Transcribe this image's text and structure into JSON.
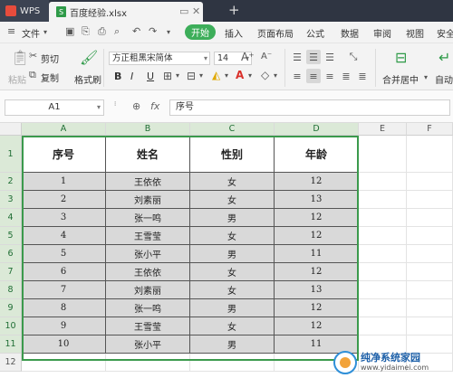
{
  "titlebar": {
    "app_label": "WPS",
    "file_tab": "百度经验.xlsx",
    "new_tab": "+"
  },
  "menubar": {
    "file": "文件",
    "start": "开始",
    "items": [
      "插入",
      "页面布局",
      "公式",
      "数据",
      "审阅",
      "视图",
      "安全"
    ]
  },
  "ribbon": {
    "paste": "粘贴",
    "cut": "剪切",
    "copy": "复制",
    "format_painter": "格式刷",
    "font_name": "方正粗黑宋简体",
    "font_size": "14",
    "bold": "B",
    "italic": "I",
    "underline": "U",
    "merge_center": "合并居中",
    "auto_wrap": "自动换"
  },
  "formulabar": {
    "cell_ref": "A1",
    "fx": "fx",
    "content": "序号"
  },
  "grid": {
    "columns": [
      "A",
      "B",
      "C",
      "D",
      "E",
      "F"
    ],
    "rows": [
      "1",
      "2",
      "3",
      "4",
      "5",
      "6",
      "7",
      "8",
      "9",
      "10",
      "11",
      "12"
    ],
    "headers": [
      "序号",
      "姓名",
      "性别",
      "年龄"
    ],
    "data": [
      [
        "1",
        "王依依",
        "女",
        "12"
      ],
      [
        "2",
        "刘素丽",
        "女",
        "13"
      ],
      [
        "3",
        "张一鸣",
        "男",
        "12"
      ],
      [
        "4",
        "王雪莹",
        "女",
        "12"
      ],
      [
        "5",
        "张小平",
        "男",
        "11"
      ],
      [
        "6",
        "王依依",
        "女",
        "12"
      ],
      [
        "7",
        "刘素丽",
        "女",
        "13"
      ],
      [
        "8",
        "张一鸣",
        "男",
        "12"
      ],
      [
        "9",
        "王雪莹",
        "女",
        "12"
      ],
      [
        "10",
        "张小平",
        "男",
        "11"
      ]
    ]
  },
  "watermark": {
    "title": "纯净系统家园",
    "url": "www.yidaimei.com"
  },
  "colors": {
    "accent": "#3dae5a",
    "selection_border": "#3b9a4c",
    "titlebar": "#2f3542",
    "cell_fill": "#d9d9d9"
  }
}
